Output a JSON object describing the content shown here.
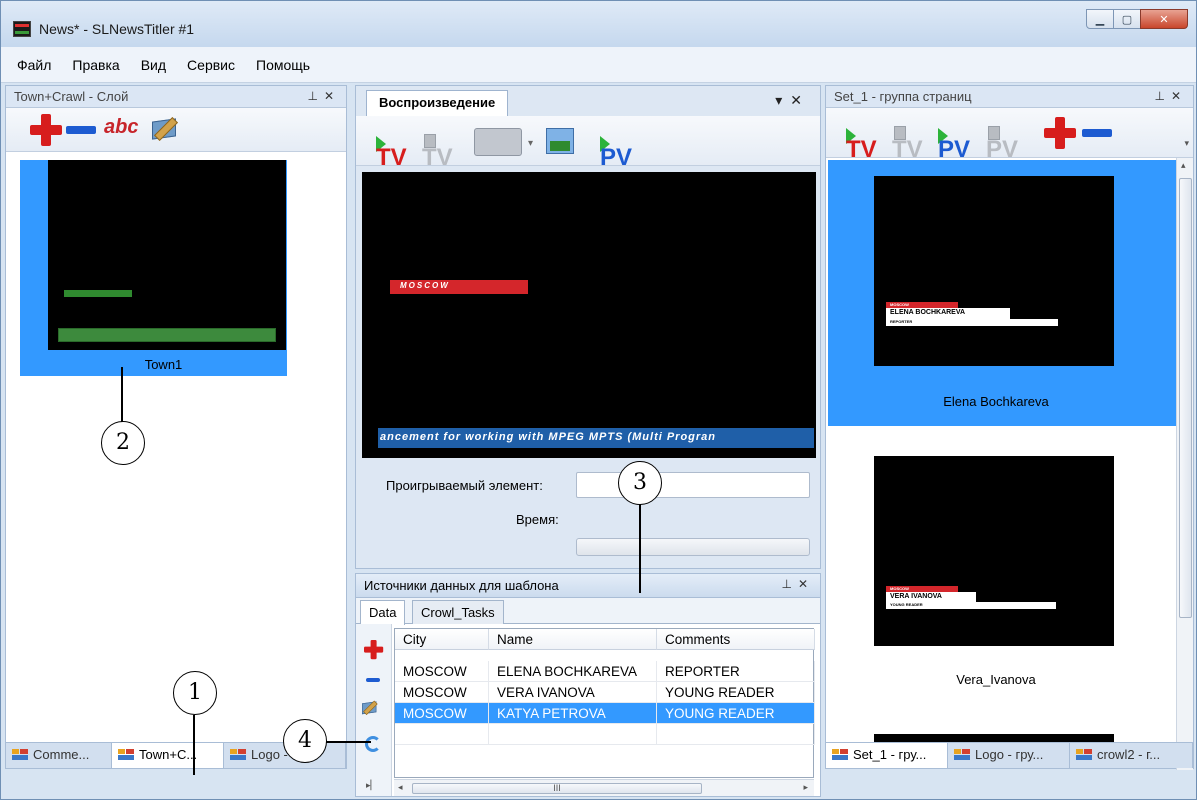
{
  "window": {
    "title": "News* - SLNewsTitler #1"
  },
  "menu": [
    "Файл",
    "Правка",
    "Вид",
    "Сервис",
    "Помощь"
  ],
  "left_panel": {
    "title": "Town+Crawl - Слой",
    "abc_label": "abc",
    "thumb_caption": "Town1",
    "tabs": [
      "Comme...",
      "Town+C...",
      "Logo - C..."
    ]
  },
  "playback": {
    "tab_label": "Воспроизведение",
    "buttons": [
      "TV",
      "TV",
      "PV"
    ],
    "preview_label": "MOSCOW",
    "crawl_text": "ancement for working with MPEG MPTS (Multi Progran",
    "playing_element_label": "Проигрываемый элемент:",
    "time_label": "Время:"
  },
  "data_sources": {
    "title": "Источники данных для шаблона",
    "tabs": [
      "Data",
      "Crowl_Tasks"
    ],
    "columns": [
      "City",
      "Name",
      "Comments"
    ],
    "rows": [
      [
        "MOSCOW",
        "ELENA BOCHKAREVA",
        "REPORTER"
      ],
      [
        "MOSCOW",
        "VERA IVANOVA",
        "YOUNG READER"
      ],
      [
        "MOSCOW",
        "KATYA PETROVA",
        "YOUNG READER"
      ]
    ],
    "selected_row": 2,
    "scroll_thumb": "III"
  },
  "right_panel": {
    "title": "Set_1 - группа страниц",
    "buttons": [
      "TV",
      "TV",
      "PV",
      "PV"
    ],
    "pages": [
      {
        "caption": "Elena Bochkareva",
        "name": "ELENA BOCHKAREVA",
        "role": "REPORTER",
        "city": "MOSCOW"
      },
      {
        "caption": "Vera_Ivanova",
        "name": "VERA IVANOVA",
        "role": "YOUNG READER",
        "city": "MOSCOW"
      }
    ],
    "tabs": [
      "Set_1 - гру...",
      "Logo - гру...",
      "crowl2 - г..."
    ]
  },
  "callouts": [
    "1",
    "2",
    "3",
    "4"
  ],
  "colors": {
    "selection": "#3399ff",
    "accent_red": "#d71d1d",
    "accent_blue": "#1d5bd1",
    "play_green": "#2cb33a"
  }
}
